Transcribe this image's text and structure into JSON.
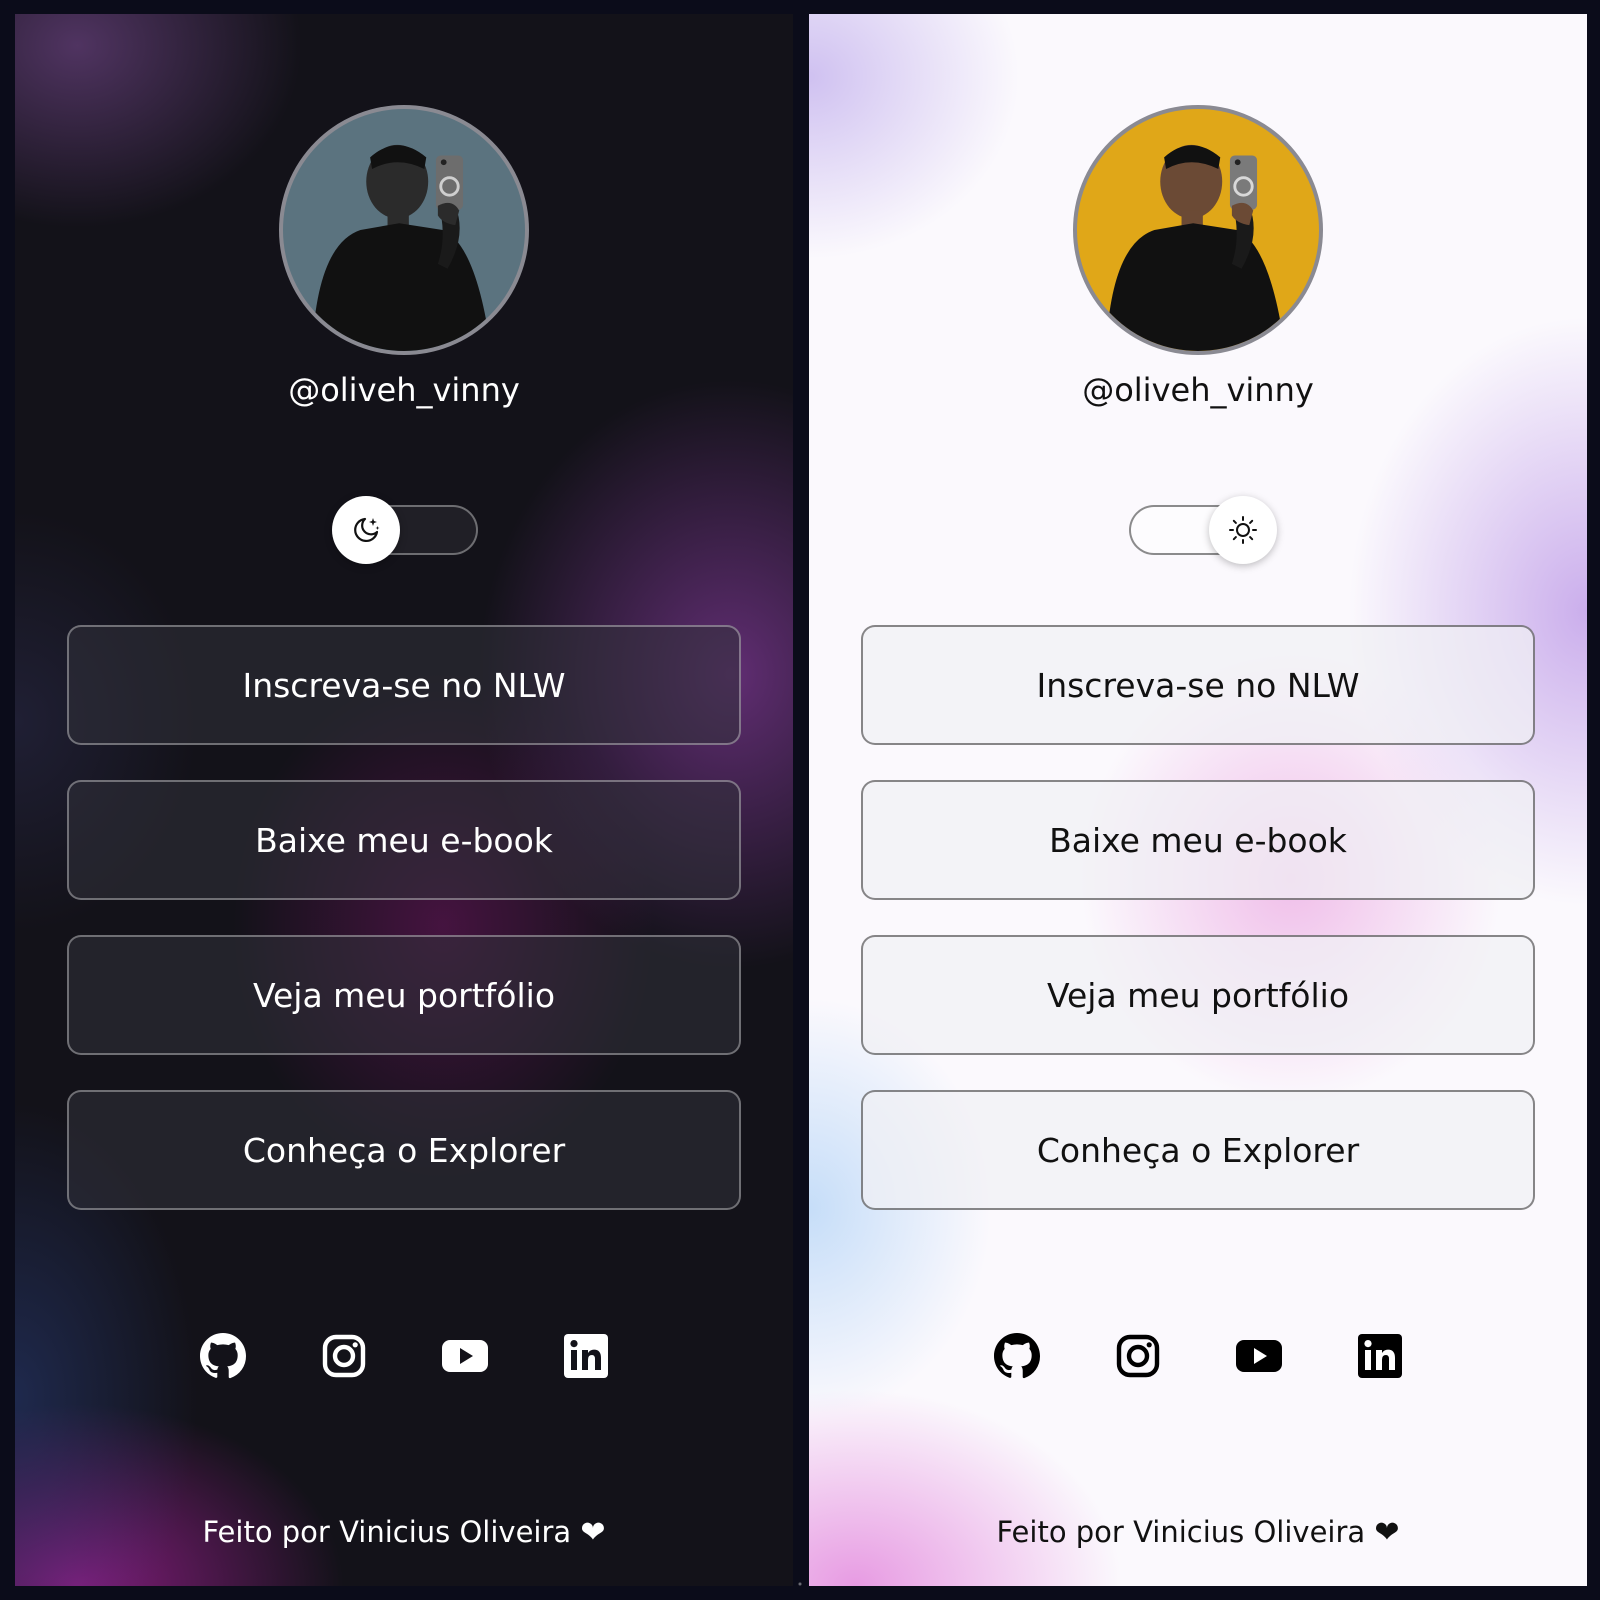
{
  "profile": {
    "handle": "@oliveh_vinny"
  },
  "theme_toggle": {
    "dark_icon": "moon-stars-icon",
    "light_icon": "sun-icon"
  },
  "links": [
    {
      "label": "Inscreva-se no NLW"
    },
    {
      "label": "Baixe meu e-book"
    },
    {
      "label": "Veja meu portfólio"
    },
    {
      "label": "Conheça o Explorer"
    }
  ],
  "social": [
    {
      "icon": "github-icon"
    },
    {
      "icon": "instagram-icon"
    },
    {
      "icon": "youtube-icon"
    },
    {
      "icon": "linkedin-icon"
    }
  ],
  "footer": {
    "text": "Feito por Vinicius Oliveira",
    "heart": "❤"
  },
  "colors": {
    "dark_background": "#131219",
    "dark_accent": "#7a2d8a",
    "light_background": "#fbf9fd",
    "light_accent": "#e3a2e0",
    "avatar_dark_bg": "#5b737f",
    "avatar_light_bg": "#e0a718"
  }
}
